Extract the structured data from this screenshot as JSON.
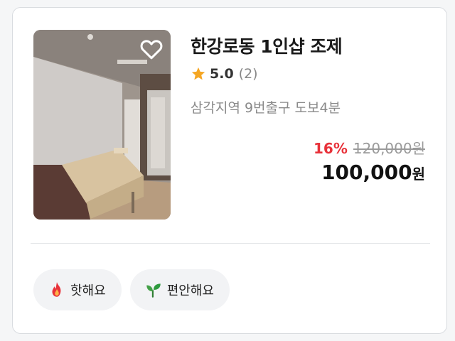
{
  "listing": {
    "title": "한강로동 1인샵 조제",
    "rating": "5.0",
    "review_count": "(2)",
    "location": "삼각지역 9번출구 도보4분",
    "discount": "16%",
    "original_price": "120,000원",
    "final_price": "100,000",
    "currency": "원"
  },
  "tags": [
    {
      "label": "핫해요",
      "icon": "fire-icon"
    },
    {
      "label": "편안해요",
      "icon": "leaf-icon"
    }
  ],
  "colors": {
    "discount": "#e8323a",
    "star": "#f5a623",
    "tag_bg": "#f2f3f5"
  }
}
